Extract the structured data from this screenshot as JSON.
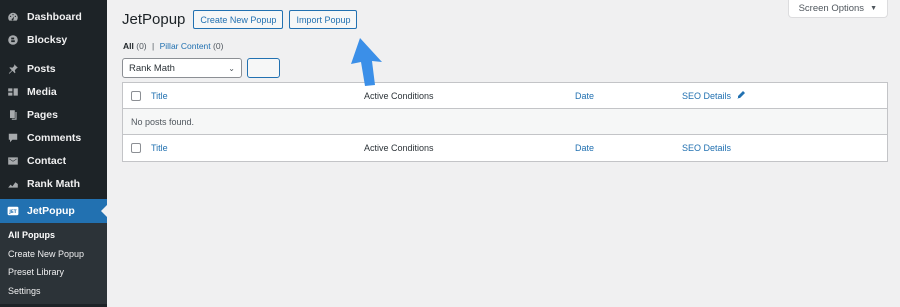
{
  "sidebar": {
    "items": [
      {
        "label": "Dashboard",
        "icon": "dashboard-icon"
      },
      {
        "label": "Blocksy",
        "icon": "blocksy-icon"
      },
      {
        "label": "Posts",
        "icon": "pin-icon"
      },
      {
        "label": "Media",
        "icon": "media-icon"
      },
      {
        "label": "Pages",
        "icon": "pages-icon"
      },
      {
        "label": "Comments",
        "icon": "comment-icon"
      },
      {
        "label": "Contact",
        "icon": "mail-icon"
      },
      {
        "label": "Rank Math",
        "icon": "rankmath-icon"
      },
      {
        "label": "JetPopup",
        "icon": "jetpopup-icon",
        "active": true
      }
    ],
    "submenu": [
      {
        "label": "All Popups",
        "current": true
      },
      {
        "label": "Create New Popup"
      },
      {
        "label": "Preset Library"
      },
      {
        "label": "Settings"
      }
    ]
  },
  "header": {
    "screen_options": "Screen Options",
    "title": "JetPopup",
    "create_button": "Create New Popup",
    "import_button": "Import Popup"
  },
  "views": {
    "all_label": "All",
    "all_count": "(0)",
    "separator": "|",
    "pillar_label": "Pillar Content",
    "pillar_count": "(0)"
  },
  "filter": {
    "select_value": "Rank Math"
  },
  "table": {
    "columns": {
      "title": "Title",
      "conditions": "Active Conditions",
      "date": "Date",
      "seo": "SEO Details"
    },
    "empty_message": "No posts found."
  },
  "colors": {
    "accent": "#2271b1",
    "sidebar_bg": "#1d2327",
    "arrow": "#3b8fe8"
  }
}
